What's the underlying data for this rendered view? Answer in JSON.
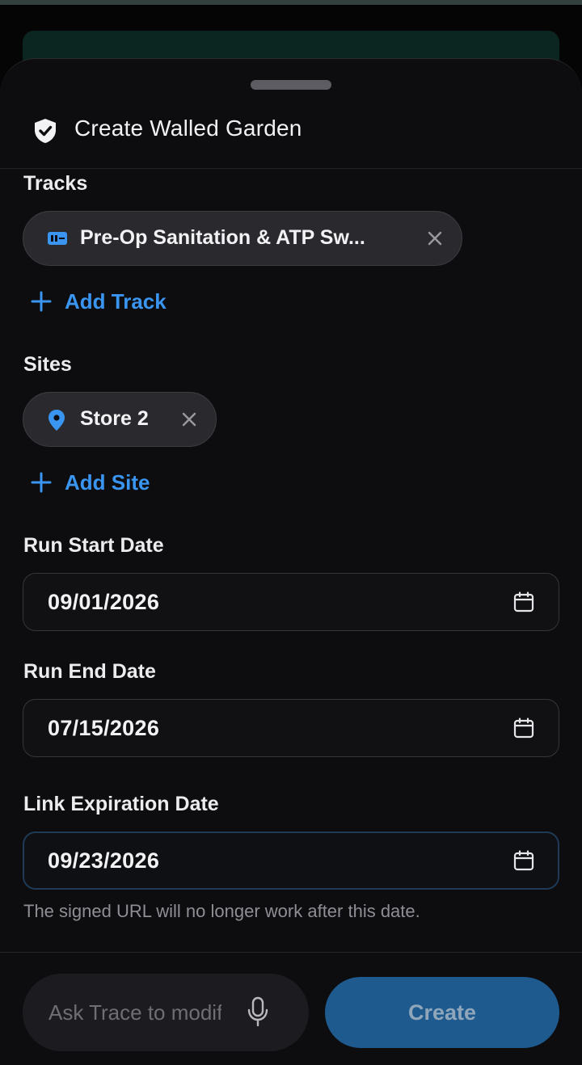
{
  "sheet": {
    "title": "Create Walled Garden"
  },
  "tracks": {
    "label": "Tracks",
    "chip_text": "Pre-Op Sanitation & ATP Sw...",
    "add_label": "Add Track"
  },
  "sites": {
    "label": "Sites",
    "chip_text": "Store 2",
    "add_label": "Add Site"
  },
  "run_start": {
    "label": "Run Start Date",
    "value": "09/01/2026"
  },
  "run_end": {
    "label": "Run End Date",
    "value": "07/15/2026"
  },
  "link_expiration": {
    "label": "Link Expiration Date",
    "value": "09/23/2026",
    "helper": "The signed URL will no longer work after this date."
  },
  "footer": {
    "ask_placeholder": "Ask Trace to modify",
    "create_label": "Create"
  },
  "colors": {
    "accent": "#3a95f0",
    "create_button": "#1f5a8e",
    "sheet_bg": "#0d0d10"
  },
  "icons": {
    "header": "shield-check-icon",
    "track_chip": "track-icon",
    "site_chip": "map-pin-icon",
    "date": "calendar-icon",
    "voice": "microphone-icon"
  }
}
